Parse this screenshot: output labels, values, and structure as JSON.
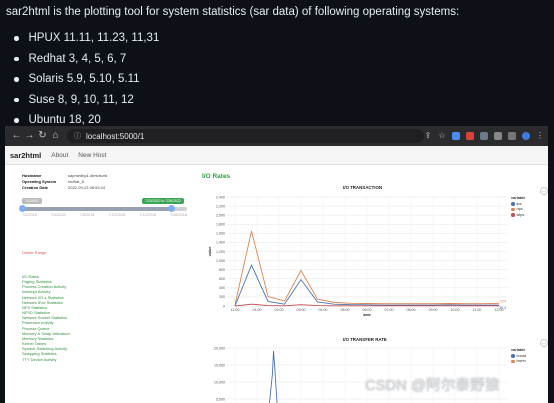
{
  "intro_text": "sar2html is the plotting tool for system statistics (sar data) of following operating systems:",
  "os_list": [
    "HPUX 11.11, 11.23, 11,31",
    "Redhat 3, 4, 5, 6, 7",
    "Solaris 5.9, 5.10, 5.11",
    "Suse 8, 9, 10, 11, 12",
    "Ubuntu 18, 20"
  ],
  "browser": {
    "url": "localhost:5000/1",
    "nav_icons": [
      "back-arrow-icon",
      "forward-arrow-icon",
      "reload-icon",
      "home-icon"
    ]
  },
  "app": {
    "brand": "sar2html",
    "nav": [
      "About",
      "New Host"
    ]
  },
  "host_info": [
    {
      "key": "Hostname",
      "value": "sapmedbp1.dlmidsvr8"
    },
    {
      "key": "Operating System",
      "value": "redhat_8"
    },
    {
      "key": "Creation Date",
      "value": "2022-09-23 08:53:24"
    }
  ],
  "range": {
    "start_tag": "7/2/2022",
    "end_tag": "7/23/2022 to 7/26/2022",
    "selected_start_fraction": 0.0,
    "selected_end_fraction": 0.9,
    "dates": [
      "7/2/2018",
      "7/4/2018",
      "7/8/2018",
      "7/10/2018",
      "7/14/2018",
      "7/16/2018"
    ]
  },
  "delete_range": "Delete Range",
  "stat_links": [
    "I/O Rates",
    "Paging Statistics",
    "Process Creation Activity",
    "Interrupt Activity",
    "Network I/O a Statistics",
    "Network IFce Statistics",
    "NFS Statistics",
    "NFSD Statistics",
    "Network Socket Statistics",
    "Processor Activity",
    "Process Queue",
    "Memory & Swap Utilization",
    "Memory Statistics",
    "Kernel Tables",
    "System Switching Activity",
    "Swapping Statistics",
    "TTY Device Activity"
  ],
  "section_title": "I/O Rates",
  "chart_data": [
    {
      "type": "line",
      "title": "I/O TRANSACTION",
      "xlabel": "date",
      "ylabel": "value",
      "ylim": [
        0,
        2400
      ],
      "yticks": [
        "0",
        "200",
        "400",
        "600",
        "800",
        "1,000",
        "1,200",
        "1,400",
        "1,600",
        "1,800",
        "2,000",
        "2,200",
        "2,400"
      ],
      "categories": [
        "12:00",
        "01:00",
        "02:00",
        "03:00",
        "04:00",
        "05:00",
        "06:00",
        "07:00",
        "08:00",
        "09:00",
        "10:00",
        "11:00",
        "12:00"
      ],
      "legend_title": "variable",
      "legend_position": "right",
      "grid": true,
      "series": [
        {
          "name": "tps",
          "color": "#4c72b0",
          "values": [
            5,
            900,
            100,
            40,
            580,
            90,
            40,
            30,
            25,
            20,
            20,
            20,
            20,
            25,
            20,
            20,
            20
          ]
        },
        {
          "name": "rtps",
          "color": "#dd8452",
          "values": [
            30,
            1650,
            210,
            110,
            780,
            150,
            80,
            60,
            55,
            50,
            50,
            50,
            50,
            55,
            50,
            50,
            60
          ]
        },
        {
          "name": "wtps",
          "color": "#c44e52",
          "values": [
            0,
            40,
            10,
            5,
            30,
            10,
            5,
            3,
            3,
            3,
            3,
            3,
            3,
            3,
            3,
            3,
            3
          ]
        }
      ],
      "end_labels": [
        "224",
        "36.4"
      ]
    },
    {
      "type": "line",
      "title": "I/O TRANSFER RATE",
      "ylim": [
        0,
        20000
      ],
      "yticks": [
        "20,000",
        "15,000",
        "10,000",
        "5,000"
      ],
      "legend_title": "variable",
      "legend_position": "right",
      "series": [
        {
          "name": "bread",
          "color": "#4c72b0"
        },
        {
          "name": "bwrtn",
          "color": "#dd8452"
        }
      ]
    }
  ],
  "watermark": "CSDN @阿尔泰野狼"
}
